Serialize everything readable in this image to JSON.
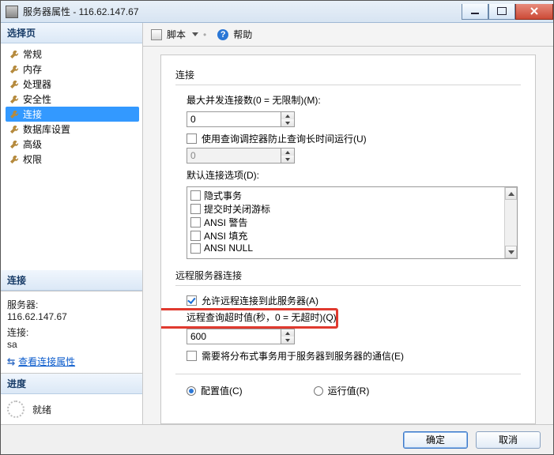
{
  "window": {
    "title": "服务器属性 - 116.62.147.67"
  },
  "sidebar": {
    "header": "选择页",
    "items": [
      {
        "label": "常规"
      },
      {
        "label": "内存"
      },
      {
        "label": "处理器"
      },
      {
        "label": "安全性"
      },
      {
        "label": "连接",
        "selected": true
      },
      {
        "label": "数据库设置"
      },
      {
        "label": "高级"
      },
      {
        "label": "权限"
      }
    ],
    "connection": {
      "header": "连接",
      "server_label": "服务器:",
      "server_value": "116.62.147.67",
      "conn_label": "连接:",
      "conn_value": "sa",
      "view_link": "查看连接属性"
    },
    "progress": {
      "header": "进度",
      "status": "就绪"
    }
  },
  "toolbar": {
    "script": "脚本",
    "help": "帮助"
  },
  "main": {
    "sections": {
      "conn_header": "连接",
      "max_conn_label": "最大并发连接数(0 = 无限制)(M):",
      "max_conn_value": "0",
      "use_governor": "使用查询调控器防止查询长时间运行(U)",
      "governor_value": "0",
      "default_opts_label": "默认连接选项(D):",
      "opts": [
        "隐式事务",
        "提交时关闭游标",
        "ANSI 警告",
        "ANSI 填充",
        "ANSI NULL"
      ],
      "remote_header": "远程服务器连接",
      "allow_remote": "允许远程连接到此服务器(A)",
      "remote_timeout_label": "远程查询超时值(秒，0 = 无超时)(Q):",
      "remote_timeout_value": "600",
      "dtc_label": "需要将分布式事务用于服务器到服务器的通信(E)",
      "radio_configured": "配置值(C)",
      "radio_running": "运行值(R)"
    }
  },
  "footer": {
    "ok": "确定",
    "cancel": "取消"
  }
}
